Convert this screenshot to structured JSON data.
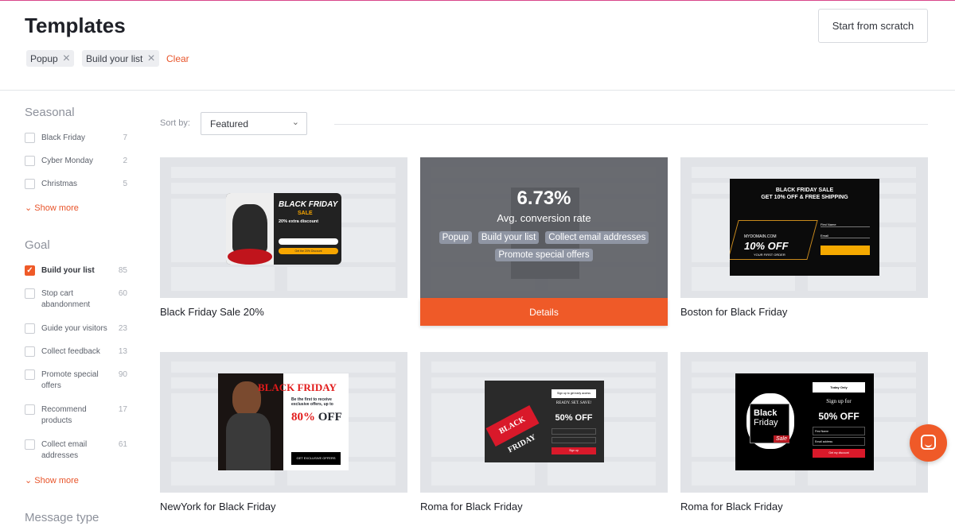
{
  "header": {
    "title": "Templates",
    "filters": [
      "Popup",
      "Build your list"
    ],
    "clear": "Clear",
    "start_button": "Start from scratch"
  },
  "sidebar": {
    "seasonal": {
      "title": "Seasonal",
      "items": [
        {
          "label": "Black Friday",
          "count": "7"
        },
        {
          "label": "Cyber Monday",
          "count": "2"
        },
        {
          "label": "Christmas",
          "count": "5"
        }
      ],
      "more": "Show more"
    },
    "goal": {
      "title": "Goal",
      "items": [
        {
          "label": "Build your list",
          "count": "85",
          "checked": true
        },
        {
          "label": "Stop cart abandonment",
          "count": "60"
        },
        {
          "label": "Guide your visitors",
          "count": "23"
        },
        {
          "label": "Collect feedback",
          "count": "13"
        },
        {
          "label": "Promote special offers",
          "count": "90"
        },
        {
          "label": "Recommend products",
          "count": "17"
        },
        {
          "label": "Collect email addresses",
          "count": "61"
        }
      ],
      "more": "Show more"
    },
    "message_type": {
      "title": "Message type"
    }
  },
  "sort": {
    "label": "Sort by:",
    "value": "Featured"
  },
  "cards": [
    {
      "title": "Black Friday Sale 20%",
      "popup": {
        "h1": "BLACK FRIDAY",
        "h2": "SALE",
        "h3": "20% extra discount",
        "cta": "Get the 20% Discount"
      }
    },
    {
      "title": "",
      "hover": {
        "rate": "6.73%",
        "rate_label": "Avg. conversion rate",
        "tags": [
          "Popup",
          "Build your list",
          "Collect email addresses",
          "Promote special offers"
        ],
        "button": "Details"
      }
    },
    {
      "title": "Boston for Black Friday",
      "popup": {
        "h1": "BLACK FRIDAY SALE",
        "h2": "GET 10% OFF & FREE SHIPPING",
        "domain": "MYDOMAIN.COM",
        "offer": "10% OFF",
        "sub": "YOUR FIRST ORDER",
        "f1": "First Name",
        "f2": "Email"
      }
    },
    {
      "title": "NewYork for Black Friday",
      "popup": {
        "h1": "BLACK FRIDAY",
        "text": "Be the first to receive exclusive offers, up to",
        "offer": "80%",
        "off": "OFF",
        "cta": "GET EXCLUSIVE OFFERS"
      }
    },
    {
      "title": "Roma for Black Friday",
      "popup": {
        "tag": "BLACK FRIDAY",
        "top": "Sign up to get early access",
        "h2": "READY. SET. SAVE!",
        "offer": "50% OFF",
        "cta": "Sign up"
      }
    },
    {
      "title": "Roma for Black Friday",
      "popup": {
        "b1": "Black",
        "b2": "Friday",
        "sale": "Sale",
        "top": "Today Only",
        "h2": "Sign up for",
        "offer": "50% OFF",
        "f1": "First Name",
        "f2": "Email address",
        "cta": "Get my discount"
      }
    }
  ],
  "colors": {
    "accent": "#ef5a28",
    "overlay": "#5f6166"
  }
}
